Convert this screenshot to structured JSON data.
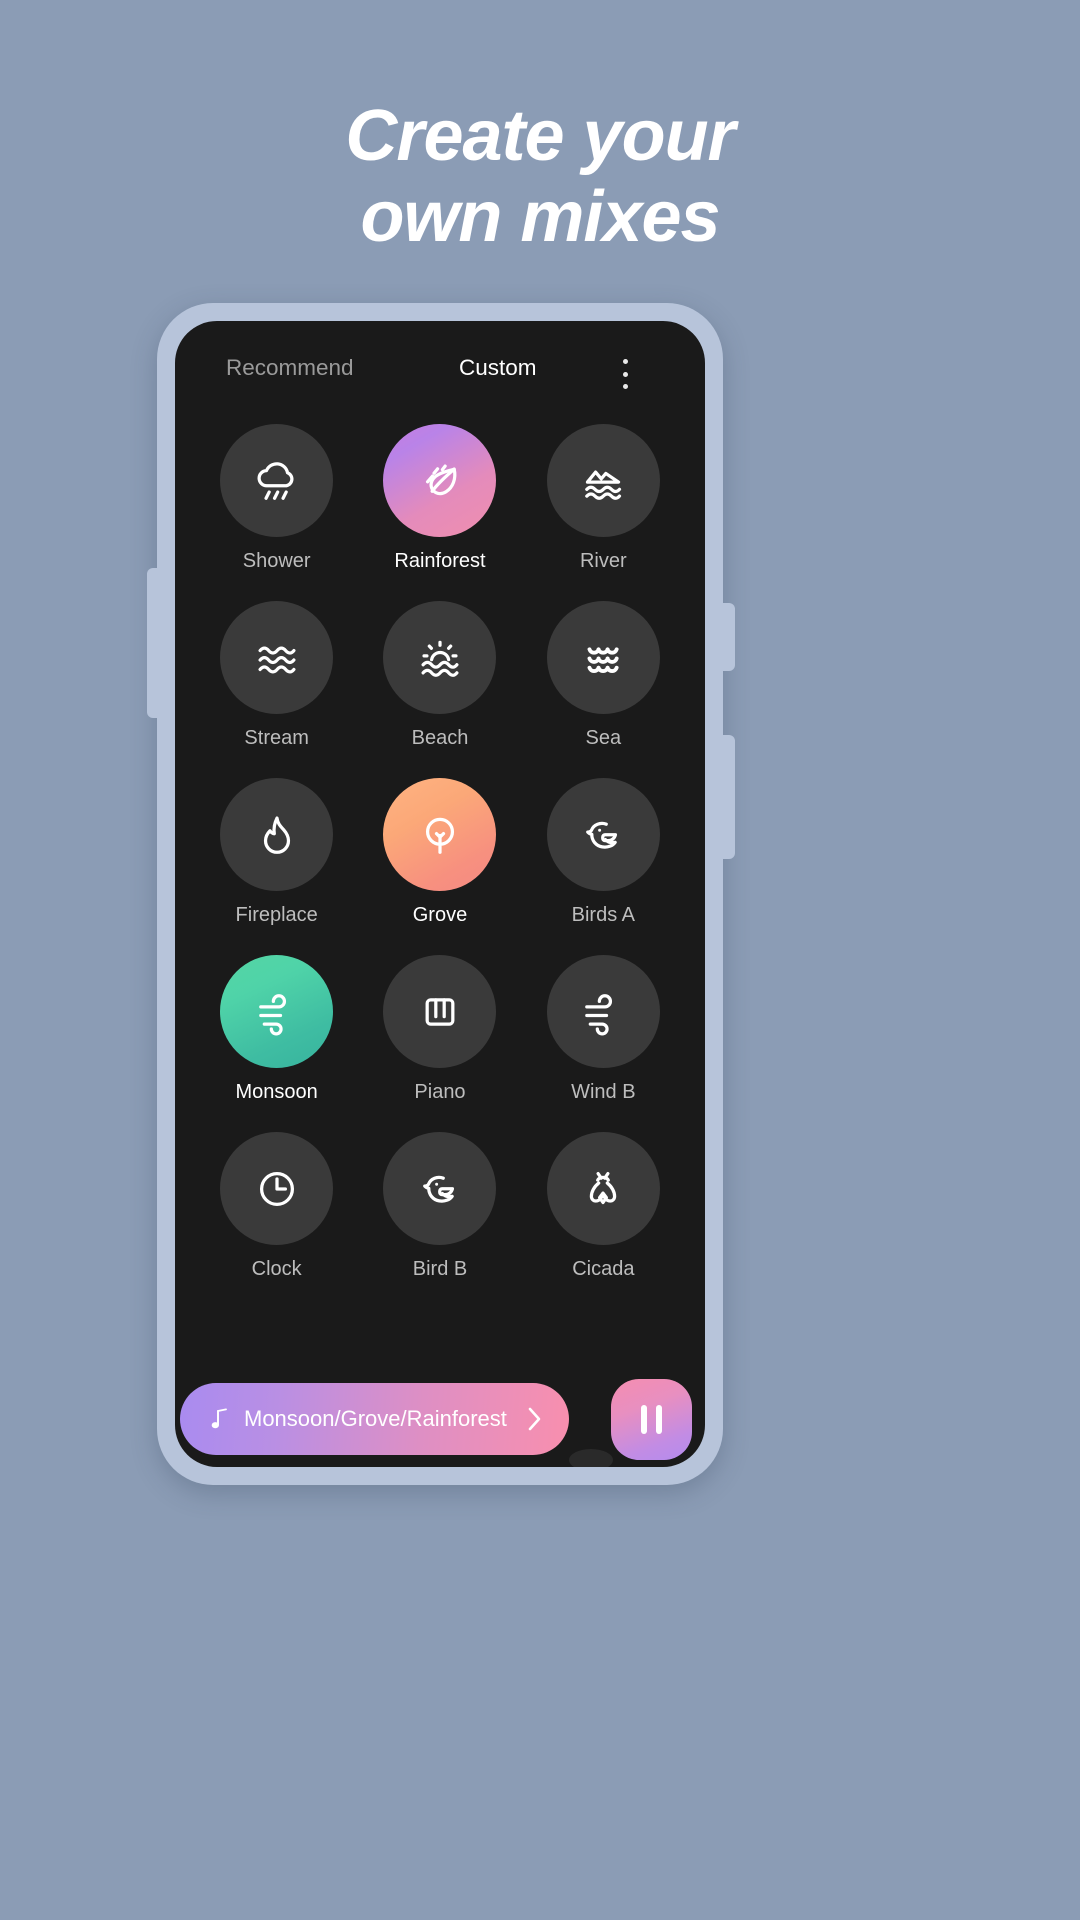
{
  "headline": {
    "line1": "Create your",
    "line2": "own mixes"
  },
  "colors": {
    "page_background": "#8b9cb5",
    "phone_frame": "#b7c4da",
    "screen_background": "#1a1a1a",
    "tile_inactive": "#3a3a3a",
    "accent_rainforest": "#c77ce0",
    "accent_grove": "#fba878",
    "accent_monsoon": "#4fd3a8",
    "player_gradient_start": "#a98bf0",
    "player_gradient_end": "#f88fae"
  },
  "topbar": {
    "tabs": [
      {
        "label": "Recommend",
        "active": false
      },
      {
        "label": "Custom",
        "active": true
      }
    ],
    "overflow_icon": "kebab-menu-icon"
  },
  "grid": {
    "items": [
      {
        "label": "Shower",
        "icon": "rain-cloud-icon",
        "active": false
      },
      {
        "label": "Rainforest",
        "icon": "leaf-icon",
        "active": true
      },
      {
        "label": "River",
        "icon": "mountain-water-icon",
        "active": false
      },
      {
        "label": "Stream",
        "icon": "waves-icon",
        "active": false
      },
      {
        "label": "Beach",
        "icon": "sun-waves-icon",
        "active": false
      },
      {
        "label": "Sea",
        "icon": "sea-waves-icon",
        "active": false
      },
      {
        "label": "Fireplace",
        "icon": "flame-icon",
        "active": false
      },
      {
        "label": "Grove",
        "icon": "tree-icon",
        "active": true
      },
      {
        "label": "Birds A",
        "icon": "bird-icon",
        "active": false
      },
      {
        "label": "Monsoon",
        "icon": "wind-icon",
        "active": true
      },
      {
        "label": "Piano",
        "icon": "piano-keys-icon",
        "active": false
      },
      {
        "label": "Wind B",
        "icon": "wind-icon",
        "active": false
      },
      {
        "label": "Clock",
        "icon": "clock-icon",
        "active": false
      },
      {
        "label": "Bird B",
        "icon": "bird-icon",
        "active": false
      },
      {
        "label": "Cicada",
        "icon": "cicada-icon",
        "active": false
      }
    ]
  },
  "player": {
    "note_icon": "music-note-icon",
    "track_title": "Monsoon/Grove/Rainforest",
    "chevron_icon": "chevron-right-icon",
    "play_state_icon": "pause-icon"
  }
}
